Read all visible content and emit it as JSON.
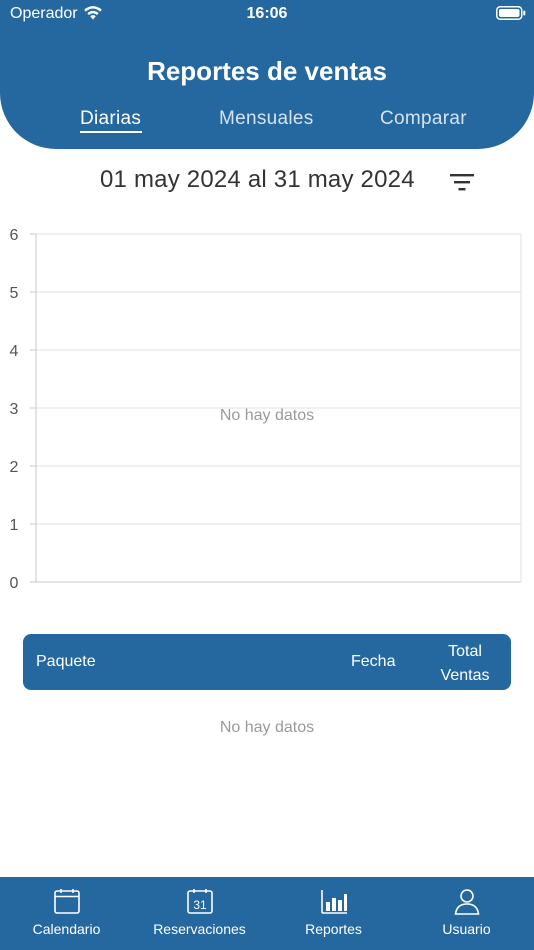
{
  "status_bar": {
    "carrier": "Operador",
    "time": "16:06"
  },
  "header": {
    "title": "Reportes de ventas",
    "tabs": [
      {
        "label": "Diarias",
        "active": true
      },
      {
        "label": "Mensuales",
        "active": false
      },
      {
        "label": "Comparar",
        "active": false
      }
    ]
  },
  "filter": {
    "date_range": "01 may 2024 al 31 may 2024",
    "icon": "filter-icon"
  },
  "chart_data": {
    "type": "bar",
    "ylim": [
      0,
      6
    ],
    "yticks": [
      "0",
      "1",
      "2",
      "3",
      "4",
      "5",
      "6"
    ],
    "categories": [],
    "values": [],
    "grid": true,
    "empty_message": "No hay datos"
  },
  "table": {
    "columns": [
      "Paquete",
      "Fecha",
      "Total Ventas"
    ],
    "rows": [],
    "empty_message": "No hay datos"
  },
  "tab_bar": {
    "items": [
      {
        "label": "Calendario",
        "icon": "calendar-icon"
      },
      {
        "label": "Reservaciones",
        "icon": "calendar-31-icon",
        "badge_text": "31"
      },
      {
        "label": "Reportes",
        "icon": "bar-chart-icon"
      },
      {
        "label": "Usuario",
        "icon": "user-icon"
      }
    ]
  },
  "colors": {
    "primary": "#24689f",
    "grid": "#e2e2e2",
    "axis": "#c8c8c8",
    "muted_text": "#9a9a9a"
  }
}
